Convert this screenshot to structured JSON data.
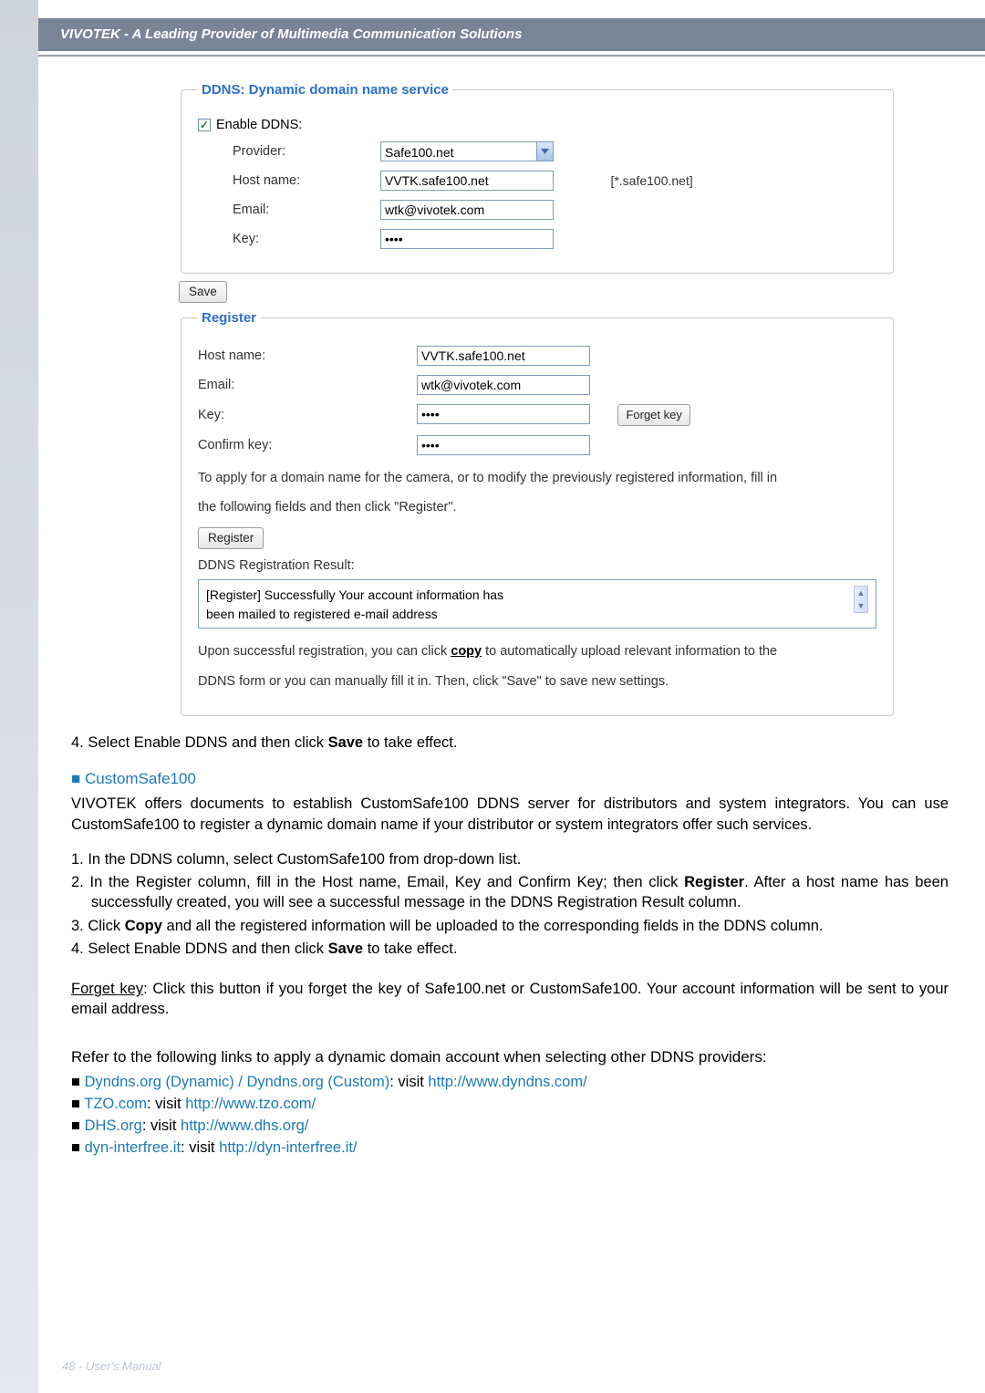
{
  "header": {
    "title": "VIVOTEK - A Leading Provider of Multimedia Communication Solutions"
  },
  "ddns": {
    "legend": "DDNS: Dynamic domain name service",
    "enable_label": "Enable DDNS:",
    "provider_label": "Provider:",
    "provider_value": "Safe100.net",
    "hostname_label": "Host name:",
    "hostname_value": "VVTK.safe100.net",
    "hostname_suffix": "[*.safe100.net]",
    "email_label": "Email:",
    "email_value": "wtk@vivotek.com",
    "key_label": "Key:",
    "key_value": "••••"
  },
  "buttons": {
    "save": "Save",
    "forget_key": "Forget key",
    "register": "Register"
  },
  "register": {
    "legend": "Register",
    "hostname_label": "Host name:",
    "hostname_value": "VVTK.safe100.net",
    "email_label": "Email:",
    "email_value": "wtk@vivotek.com",
    "key_label": "Key:",
    "key_value": "••••",
    "confirm_label": "Confirm key:",
    "confirm_value": "••••",
    "instr1": "To apply for a domain name for the camera, or to modify the previously registered information, fill in",
    "instr2": "the following fields and then click \"Register\".",
    "result_label": "DDNS Registration Result:",
    "result_line1": "[Register] Successfully  Your account information has",
    "result_line2": "been mailed to registered e-mail address",
    "post1a": "Upon successful registration, you can click ",
    "post1b": "copy",
    "post1c": " to automatically upload relevant information to the",
    "post2": "DDNS form or you can manually fill it in. Then, click \"Save\" to save new settings."
  },
  "body": {
    "step4": "4. Select Enable DDNS and then click Save to take effect.",
    "cs_head": "CustomSafe100",
    "cs_p1": "VIVOTEK offers documents to establish CustomSafe100 DDNS server for distributors and system integrators. You can use CustomSafe100 to register a dynamic domain name if your distributor or system integrators offer such services.",
    "cs_li1": "1. In the DDNS column, select CustomSafe100 from drop-down list.",
    "cs_li2": "2. In the Register column, fill in the Host name, Email, Key and Confirm Key; then click Register. After a host name has been successfully created, you will see a successful message in the DDNS Registration Result column.",
    "cs_li3": "3. Click Copy and all the registered information will be uploaded to the corresponding fields in the DDNS column.",
    "cs_li4": "4. Select Enable DDNS and then click Save to take effect.",
    "forget_p": "Forget key: Click this button if you forget the key of Safe100.net or CustomSafe100. Your account information will be sent to your email address.",
    "links_intro": "Refer to the following links to apply a dynamic domain account when selecting other DDNS providers:",
    "l1a": "Dyndns.org (Dynamic) / Dyndns.org (Custom)",
    "l1b": ": visit ",
    "l1c": "http://www.dyndns.com/",
    "l2a": "TZO.com",
    "l2b": ": visit ",
    "l2c": "http://www.tzo.com/",
    "l3a": "DHS.org",
    "l3b": ": visit ",
    "l3c": "http://www.dhs.org/",
    "l4a": "dyn-interfree.it",
    "l4b": ": visit ",
    "l4c": "http://dyn-interfree.it/"
  },
  "footer": {
    "text": "48 - User's Manual"
  }
}
